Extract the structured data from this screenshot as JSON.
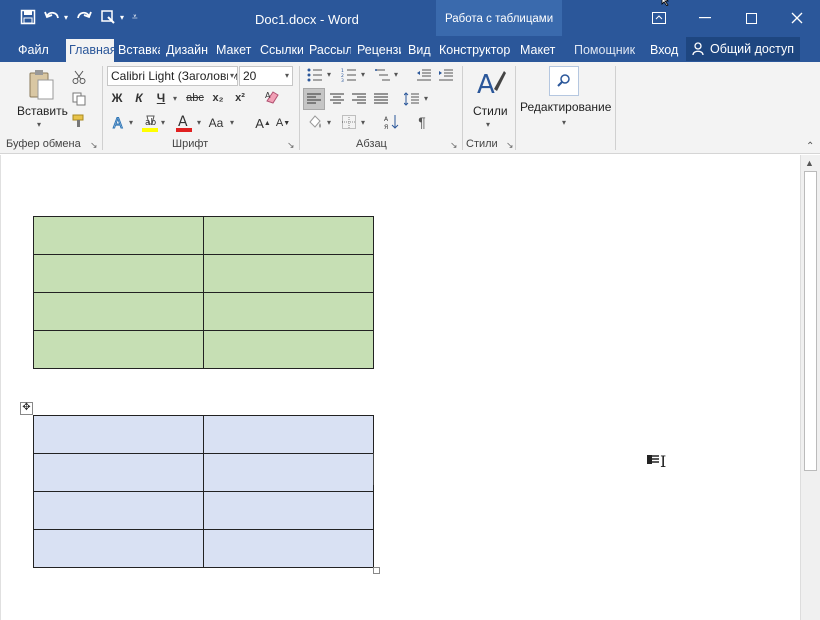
{
  "window": {
    "doc_title": "Doc1.docx - Word",
    "context_group": "Работа с таблицами"
  },
  "tabs": {
    "file": "Файл",
    "home": "Главная",
    "insert": "Вставка",
    "design": "Дизайн",
    "layout": "Макет",
    "references": "Ссылки",
    "mailings": "Рассылки",
    "review": "Рецензирование",
    "view": "Вид",
    "table_design": "Конструктор",
    "table_layout": "Макет",
    "tell_me": "Помощник",
    "signin": "Вход",
    "share": "Общий доступ"
  },
  "ribbon": {
    "clipboard": {
      "label": "Буфер обмена",
      "paste": "Вставить"
    },
    "font": {
      "label": "Шрифт",
      "font_name": "Calibri Light (Заголовки)",
      "font_size": "20",
      "bold": "Ж",
      "italic": "К",
      "underline": "Ч",
      "strike": "abc",
      "subscript": "x₂",
      "superscript": "x²"
    },
    "paragraph": {
      "label": "Абзац",
      "pilcrow": "¶"
    },
    "styles": {
      "label": "Стили",
      "button": "Стили"
    },
    "editing": {
      "button": "Редактирование"
    }
  },
  "colors": {
    "brand": "#2b579a",
    "green_table": "#c6dfb4",
    "blue_table": "#d9e1f3",
    "highlight_yellow": "#ffff00",
    "font_red": "#e02020"
  }
}
